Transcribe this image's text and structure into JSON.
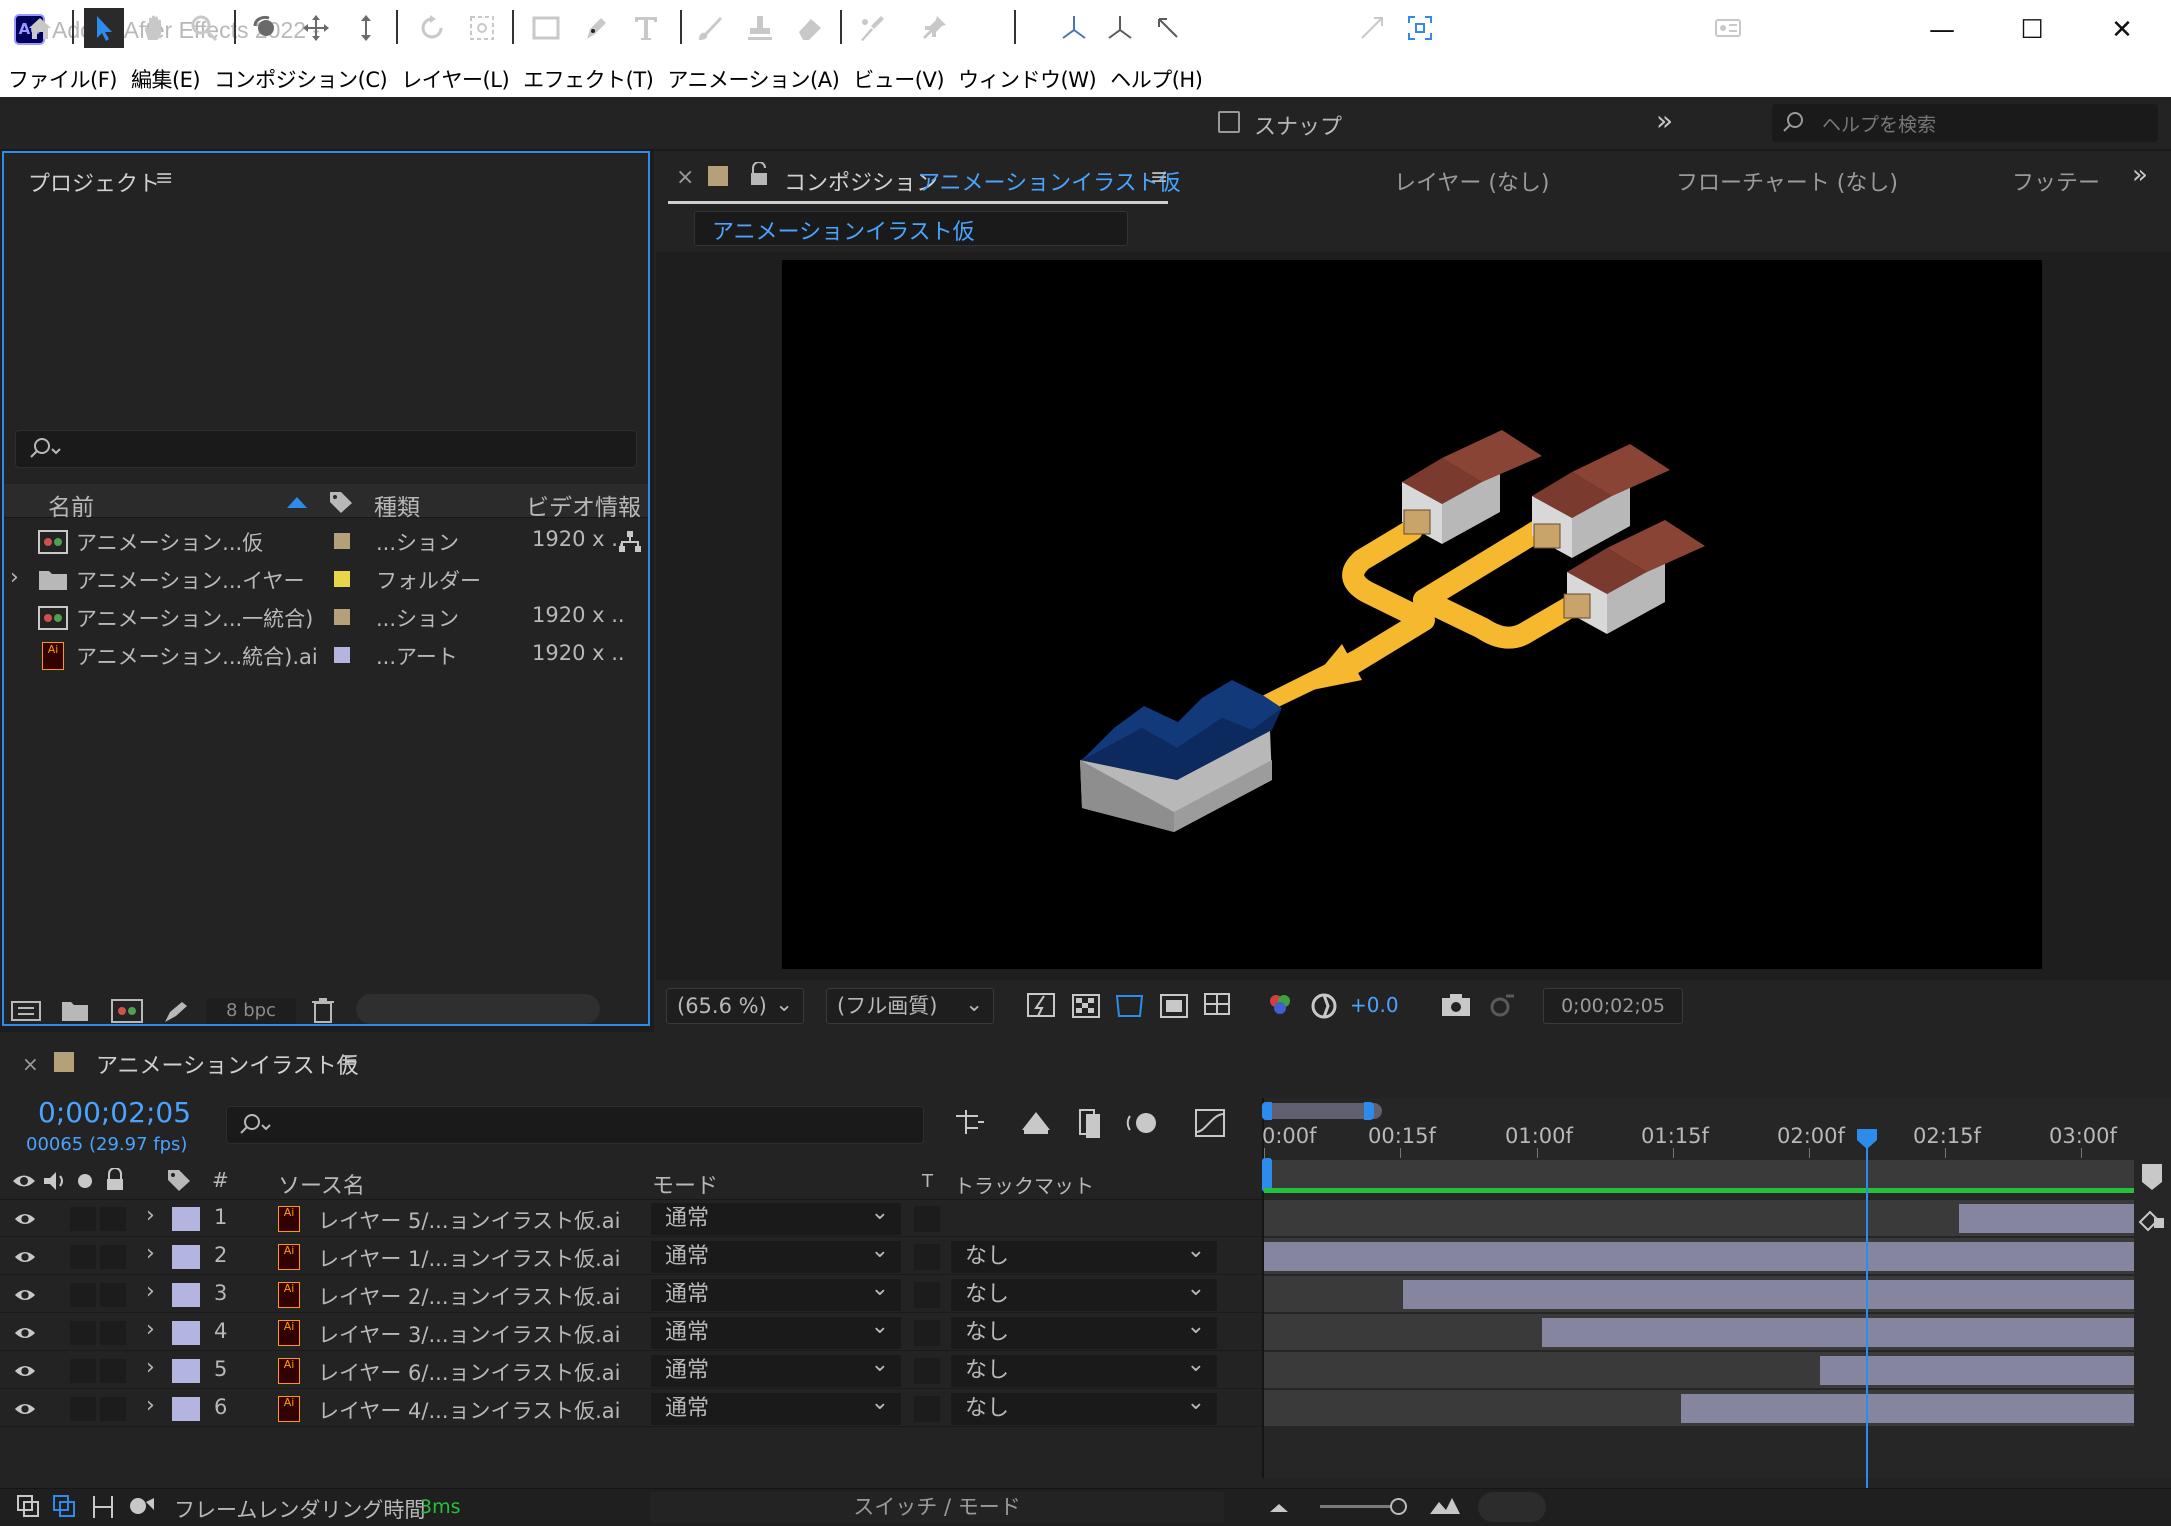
{
  "window": {
    "title": "Adobe After Effects 2022 -",
    "app_badge": "Ae",
    "controls": {
      "minimize": "—",
      "maximize": "☐",
      "close": "✕"
    }
  },
  "menubar": {
    "items": [
      "ファイル(F)",
      "編集(E)",
      "コンポジション(C)",
      "レイヤー(L)",
      "エフェクト(T)",
      "アニメーション(A)",
      "ビュー(V)",
      "ウィンドウ(W)",
      "ヘルプ(H)"
    ]
  },
  "toolbar": {
    "snap_label": "スナップ",
    "help_search_placeholder": "ヘルプを検索",
    "overflow": "»"
  },
  "project": {
    "title": "プロジェクト",
    "menu_icon": "≡",
    "columns": {
      "name": "名前",
      "type": "種類",
      "video": "ビデオ情報"
    },
    "items": [
      {
        "name": "アニメーション...仮",
        "type": "...ション",
        "video": "1920 x ..",
        "swatch": "#b5a07a",
        "icon": "composition-icon"
      },
      {
        "name": "アニメーション...イヤー",
        "type": "フォルダー",
        "video": "",
        "swatch": "#e8d64a",
        "icon": "folder-icon",
        "expander": "›"
      },
      {
        "name": "アニメーション...一統合)",
        "type": "...ション",
        "video": "1920 x ..",
        "swatch": "#b5a07a",
        "icon": "composition-icon"
      },
      {
        "name": "アニメーション...統合).ai",
        "type": "...アート",
        "video": "1920 x ..",
        "swatch": "#b4b4e0",
        "icon": "ai-file-icon"
      }
    ],
    "bpc": "8 bpc"
  },
  "composition": {
    "close": "×",
    "tab_prefix": "コンポジション",
    "tab_name": "アニメーションイラスト仮",
    "other_tabs": [
      "レイヤー (なし)",
      "フローチャート (なし)",
      "フッテー"
    ],
    "label": "アニメーションイラスト仮",
    "zoom": "(65.6 %)",
    "quality": "(フル画質)",
    "exposure": "+0.0",
    "time": "0;00;02;05"
  },
  "timeline": {
    "title": "アニメーションイラスト仮",
    "timecode": "0;00;02;05",
    "frames": "00065 (29.97 fps)",
    "columns": {
      "num": "#",
      "source": "ソース名",
      "mode": "モード",
      "t": "T",
      "matte": "トラックマット"
    },
    "ruler": [
      "0:00f",
      "00:15f",
      "01:00f",
      "01:15f",
      "02:00f",
      "02:15f",
      "03:00f"
    ],
    "playhead_seconds": 2.17,
    "duration_seconds": 3.13,
    "layers": [
      {
        "num": "1",
        "name": "レイヤー 5/...ョンイラスト仮.ai",
        "mode": "通常",
        "matte": "",
        "in": 2.5,
        "out": 3.13
      },
      {
        "num": "2",
        "name": "レイヤー 1/...ョンイラスト仮.ai",
        "mode": "通常",
        "matte": "なし",
        "in": 0.0,
        "out": 3.13
      },
      {
        "num": "3",
        "name": "レイヤー 2/...ョンイラスト仮.ai",
        "mode": "通常",
        "matte": "なし",
        "in": 0.5,
        "out": 3.13
      },
      {
        "num": "4",
        "name": "レイヤー 3/...ョンイラスト仮.ai",
        "mode": "通常",
        "matte": "なし",
        "in": 1.0,
        "out": 3.13
      },
      {
        "num": "5",
        "name": "レイヤー 6/...ョンイラスト仮.ai",
        "mode": "通常",
        "matte": "なし",
        "in": 2.0,
        "out": 3.13
      },
      {
        "num": "6",
        "name": "レイヤー 4/...ョンイラスト仮.ai",
        "mode": "通常",
        "matte": "なし",
        "in": 1.5,
        "out": 3.13
      }
    ],
    "render_label": "フレームレンダリング時間",
    "render_time": "3ms",
    "switch_mode": "スイッチ / モード"
  },
  "colors": {
    "accent": "#2d8ceb",
    "comp_swatch": "#b5a07a",
    "ai_swatch": "#b4b4e0",
    "green": "#23c23a",
    "bar": "#8585a0"
  }
}
